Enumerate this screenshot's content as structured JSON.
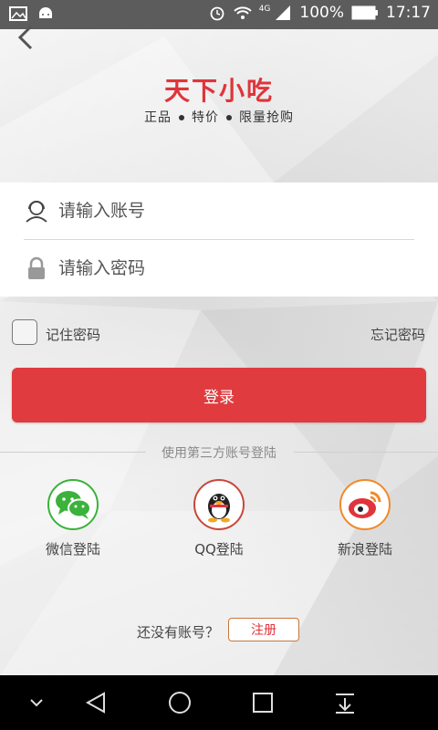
{
  "status_bar": {
    "network": "4G",
    "battery": "100%",
    "time": "17:17"
  },
  "header": {
    "logo": "天下小吃",
    "tagline": [
      "正品",
      "特价",
      "限量抢购"
    ]
  },
  "form": {
    "account_placeholder": "请输入账号",
    "password_placeholder": "请输入密码"
  },
  "options": {
    "remember_label": "记住密码",
    "forgot_label": "忘记密码"
  },
  "login_label": "登录",
  "third_party": {
    "divider": "使用第三方账号登陆",
    "wechat": "微信登陆",
    "qq": "QQ登陆",
    "weibo": "新浪登陆"
  },
  "register": {
    "prompt": "还没有账号？",
    "button": "注册"
  },
  "colors": {
    "brand_red": "#e03c3f",
    "wechat_green": "#3bb23b",
    "weibo_orange": "#f08a28"
  }
}
